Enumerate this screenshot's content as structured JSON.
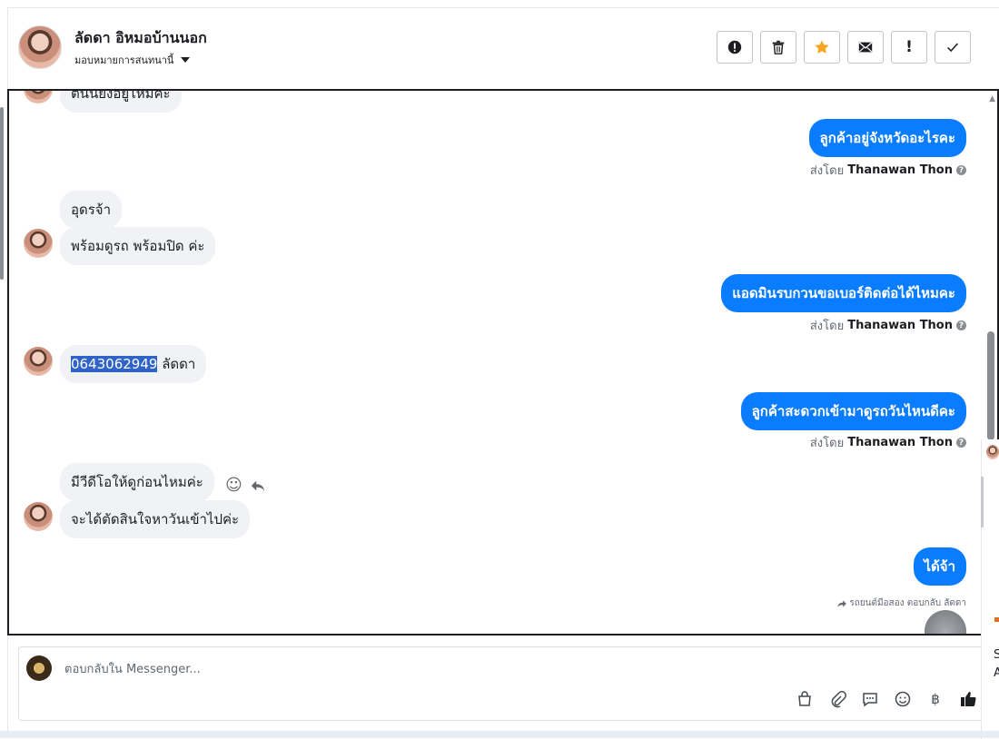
{
  "header": {
    "contact_name": "ลัดดา อิหมอบ้านนอก",
    "assign_label": "มอบหมายการสนทนานี้"
  },
  "messages": [
    {
      "dir": "in",
      "text": "ตนนยงอยู่ไหมคะ"
    },
    {
      "dir": "out",
      "text": "ลูกค้าอยู่จังหวัดอะไรคะ",
      "sent_by_prefix": "ส่งโดย",
      "sent_by_name": "Thanawan Thon"
    },
    {
      "dir": "in",
      "text": "อุดรจ้า"
    },
    {
      "dir": "in",
      "text": "พร้อมดูรถ พร้อมปิด ค่ะ"
    },
    {
      "dir": "out",
      "text": "แอดมินรบกวนขอเบอร์ติดต่อได้ไหมคะ",
      "sent_by_prefix": "ส่งโดย",
      "sent_by_name": "Thanawan Thon"
    },
    {
      "dir": "in",
      "text_highlight": "0643062949",
      "text_rest": " ลัดดา"
    },
    {
      "dir": "out",
      "text": "ลูกค้าสะดวกเข้ามาดูรถวันไหนดีคะ",
      "sent_by_prefix": "ส่งโดย",
      "sent_by_name": "Thanawan Thon"
    },
    {
      "dir": "in",
      "text": "มีวีดีโอให้ดูก่อนไหมค่ะ"
    },
    {
      "dir": "in",
      "text": "จะได้ตัดสินใจหาวันเข้าไปค่ะ"
    },
    {
      "dir": "out",
      "text": "ได้จ้า"
    }
  ],
  "reply_note": "รถยนต์มือสอง ตอบกลับ ลัดดา",
  "composer": {
    "placeholder": "ตอบกลับใน Messenger..."
  },
  "side_panel": {
    "line1": "S",
    "line2": "A"
  },
  "icons": {
    "actions": [
      "alert-circle-icon",
      "trash-icon",
      "star-icon",
      "envelope-icon",
      "exclamation-icon",
      "check-icon"
    ],
    "composer": [
      "shopping-bag-icon",
      "paperclip-icon",
      "chat-bubble-icon",
      "emoji-icon",
      "baht-icon",
      "thumbs-up-icon"
    ]
  },
  "colors": {
    "outgoing_bubble": "#0a7cff",
    "incoming_bubble": "#f0f2f5",
    "star": "#f5a623",
    "highlight": "#2f63c7"
  }
}
